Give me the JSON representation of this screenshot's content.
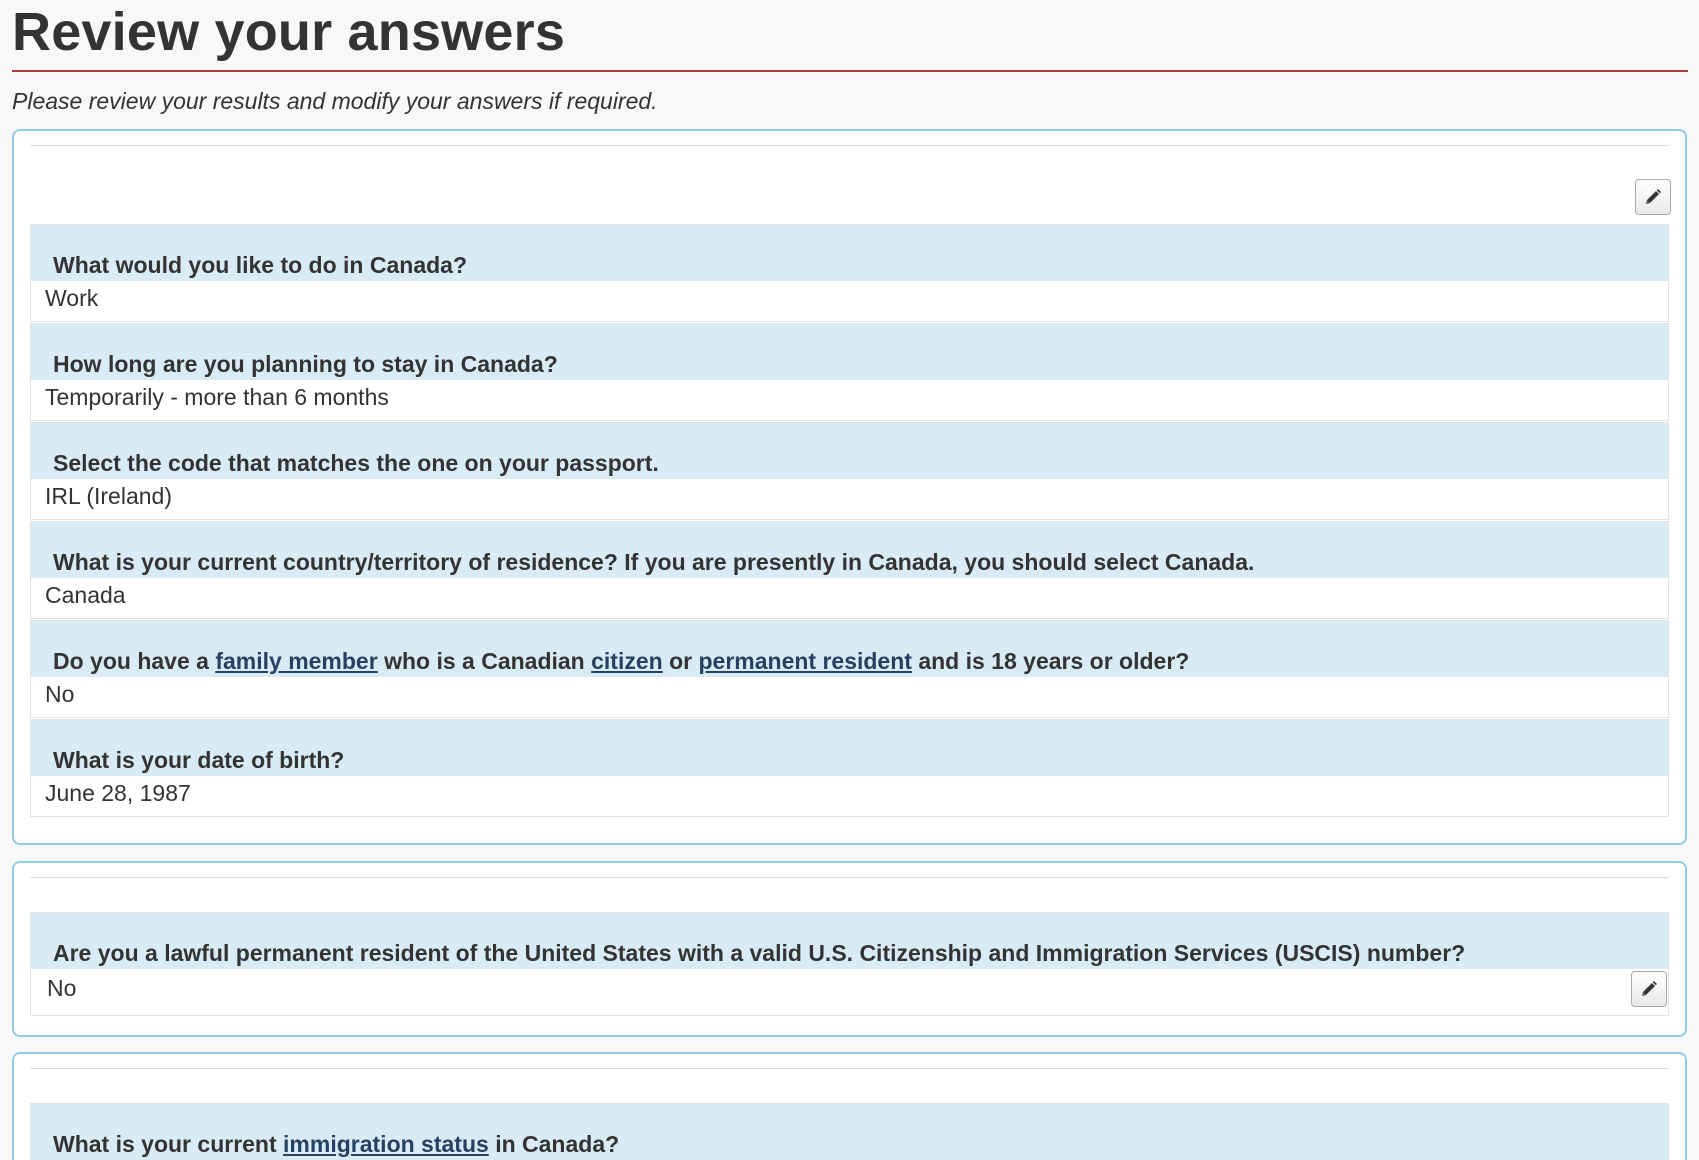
{
  "header": {
    "title": "Review your answers",
    "intro": "Please review your results and modify your answers if required."
  },
  "colors": {
    "accent_rule": "#af3c43",
    "panel_border": "#8ecce8",
    "question_bg": "#d9ebf5",
    "link": "#284162"
  },
  "panel1": {
    "edit_icon": "pencil-icon",
    "items": [
      {
        "question": "What would you like to do in Canada?",
        "answer": "Work"
      },
      {
        "question": "How long are you planning to stay in Canada?",
        "answer": "Temporarily - more than 6 months"
      },
      {
        "question": "Select the code that matches the one on your passport.",
        "answer": "IRL (Ireland)"
      },
      {
        "question": "What is your current country/territory of residence? If you are presently in Canada, you should select Canada.",
        "answer": "Canada"
      },
      {
        "question_parts": {
          "p1": "Do you have a ",
          "link1": "family member",
          "p2": " who is a Canadian ",
          "link2": "citizen",
          "p3": " or ",
          "link3": "permanent resident",
          "p4": " and is 18 years or older?"
        },
        "answer": "No"
      },
      {
        "question": "What is your date of birth?",
        "answer": "June 28, 1987"
      }
    ]
  },
  "panel2": {
    "edit_icon": "pencil-icon",
    "items": [
      {
        "question": "Are you a lawful permanent resident of the United States with a valid U.S. Citizenship and Immigration Services (USCIS) number?",
        "answer": "No"
      }
    ]
  },
  "panel3": {
    "items": [
      {
        "question_parts": {
          "p1": "What is your current ",
          "link1": "immigration status",
          "p2": " in Canada?"
        }
      }
    ]
  }
}
